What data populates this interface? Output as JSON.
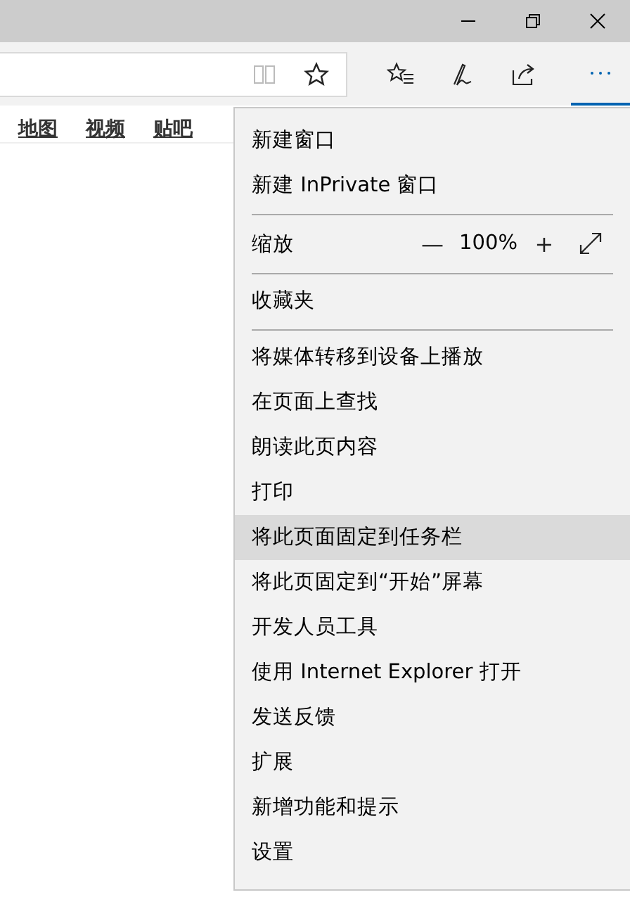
{
  "page_links": [
    {
      "label": "地图"
    },
    {
      "label": "视频"
    },
    {
      "label": "贴吧"
    }
  ],
  "menu": {
    "items": [
      {
        "kind": "item",
        "label": "新建窗口",
        "highlighted": false
      },
      {
        "kind": "item",
        "label": "新建 InPrivate 窗口",
        "highlighted": false
      },
      {
        "kind": "separator"
      },
      {
        "kind": "zoom",
        "label": "缩放",
        "minus": "—",
        "value": "100%",
        "plus": "+"
      },
      {
        "kind": "separator"
      },
      {
        "kind": "item",
        "label": "收藏夹",
        "highlighted": false
      },
      {
        "kind": "separator"
      },
      {
        "kind": "item",
        "label": "将媒体转移到设备上播放",
        "highlighted": false
      },
      {
        "kind": "item",
        "label": "在页面上查找",
        "highlighted": false
      },
      {
        "kind": "item",
        "label": "朗读此页内容",
        "highlighted": false
      },
      {
        "kind": "item",
        "label": "打印",
        "highlighted": false
      },
      {
        "kind": "item",
        "label": "将此页面固定到任务栏",
        "highlighted": true
      },
      {
        "kind": "item",
        "label": "将此页固定到“开始”屏幕",
        "highlighted": false
      },
      {
        "kind": "item",
        "label": "开发人员工具",
        "highlighted": false
      },
      {
        "kind": "item",
        "label": "使用 Internet Explorer 打开",
        "highlighted": false
      },
      {
        "kind": "item",
        "label": "发送反馈",
        "highlighted": false
      },
      {
        "kind": "item",
        "label": "扩展",
        "highlighted": false
      },
      {
        "kind": "item",
        "label": "新增功能和提示",
        "highlighted": false
      },
      {
        "kind": "item",
        "label": "设置",
        "highlighted": false
      }
    ]
  }
}
